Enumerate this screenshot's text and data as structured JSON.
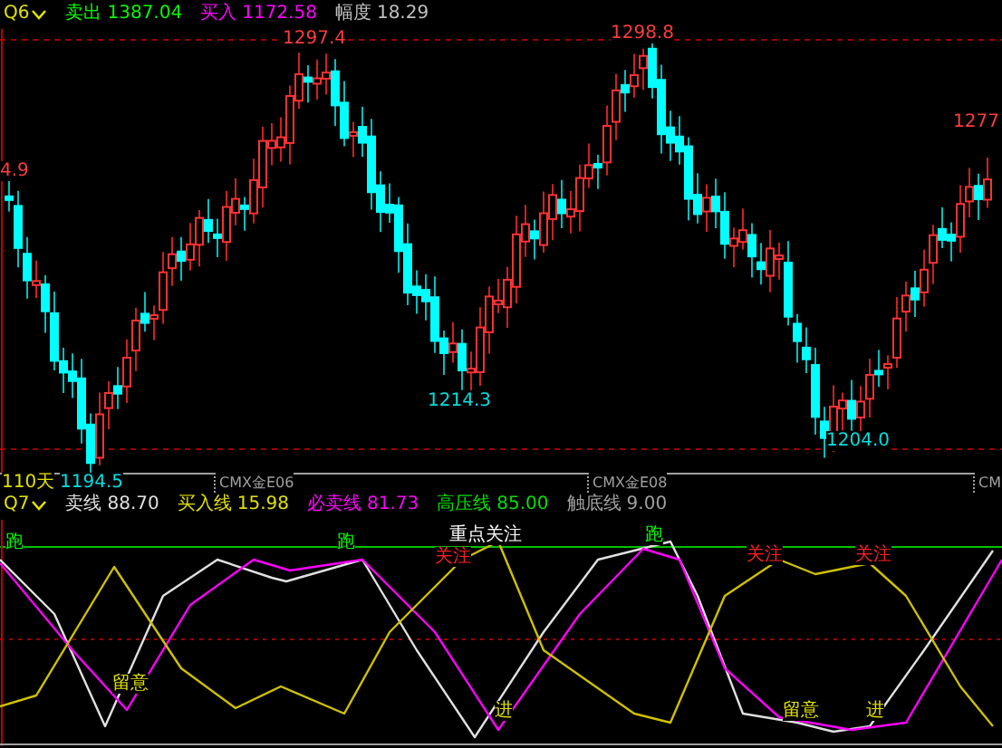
{
  "price_panel": {
    "selector": "Q6",
    "readouts": [
      {
        "label": "卖出",
        "value": "1387.04",
        "color": "#00ff00"
      },
      {
        "label": "买入",
        "value": "1172.58",
        "color": "#ff00ff"
      },
      {
        "label": "幅度",
        "value": "18.29",
        "color": "#c0c0c0"
      }
    ],
    "price_labels": [
      {
        "text": "1297.4",
        "color": "#ff3c3c"
      },
      {
        "text": "1298.8",
        "color": "#ff3c3c"
      },
      {
        "text": "4.9",
        "color": "#ff3c3c"
      },
      {
        "text": "1277",
        "color": "#ff3c3c"
      },
      {
        "text": "1214.3",
        "color": "#00e0e0"
      },
      {
        "text": "1204.0",
        "color": "#00e0e0"
      }
    ]
  },
  "axis": {
    "period": "110天",
    "low_label": "1194.5",
    "contracts": [
      "CMX金E06",
      "CMX金E08",
      "CM"
    ]
  },
  "indicator_panel": {
    "selector": "Q7",
    "readouts": [
      {
        "label": "卖线",
        "value": "88.70",
        "color": "#e0e0e0"
      },
      {
        "label": "买入线",
        "value": "15.98",
        "color": "#e0e000"
      },
      {
        "label": "必卖线",
        "value": "81.73",
        "color": "#ff00ff"
      },
      {
        "label": "高压线",
        "value": "85.00",
        "color": "#00e000"
      },
      {
        "label": "触底线",
        "value": "9.00",
        "color": "#a0a0a0"
      }
    ],
    "signals": [
      {
        "text": "跑",
        "color": "#00ff00"
      },
      {
        "text": "跑",
        "color": "#00ff00"
      },
      {
        "text": "重点关注",
        "color": "#ffffff"
      },
      {
        "text": "关注",
        "color": "#ff2020"
      },
      {
        "text": "跑",
        "color": "#00ff00"
      },
      {
        "text": "关注",
        "color": "#ff2020"
      },
      {
        "text": "关注",
        "color": "#ff2020"
      },
      {
        "text": "留意",
        "color": "#e0e000"
      },
      {
        "text": "进",
        "color": "#e0e000"
      },
      {
        "text": "留意",
        "color": "#e0e000"
      },
      {
        "text": "进",
        "color": "#e0e000"
      }
    ]
  }
}
